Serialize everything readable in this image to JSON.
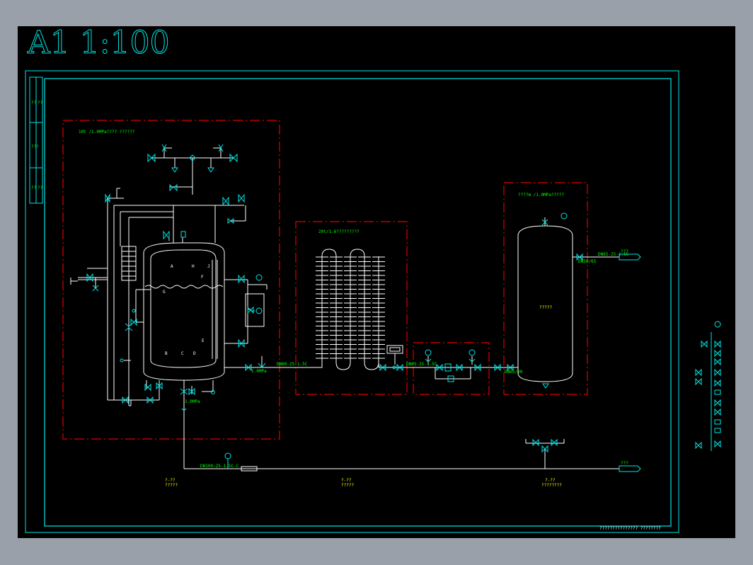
{
  "window": {
    "background": "#9aa0a9",
    "canvas_background": "#000000"
  },
  "colors": {
    "frame": "#00e5e5",
    "pipe": "#ffffff",
    "boundary": "#e00000",
    "text": "#00ff00",
    "note": "#ffff00"
  },
  "sheet": {
    "scale_title": "A1 1:100",
    "title_block_text": "???????????????  ????????"
  },
  "zones": {
    "boiler_room": {
      "label": "10t /1.0MPa???? ??????"
    },
    "cooler": {
      "label": "20t/1.6?????????"
    },
    "tank": {
      "label": "????m /1.0MPa?????"
    }
  },
  "pipe_labels": {
    "boiler_steam_out": "1.0MPa",
    "main_steam": "DN80-25-1.5C",
    "cooler_out": "DN65-25-1.5C",
    "tank_inlet": "DN65/80",
    "tank_outlet": "DN65-25-1.5C",
    "tank_outlet_size": "DN50/65",
    "boiler_down": "1.0MPa",
    "bottom_main": "DN100-25-1.5C-C",
    "outlet_top_arrow": "???",
    "outlet_bottom_arrow": "???"
  },
  "boiler_nozzles": [
    "A",
    "H",
    "J",
    "F",
    "G",
    "E",
    "B",
    "C",
    "D"
  ],
  "tank_center_label": "?????",
  "notes": [
    {
      "top": "?-??",
      "bottom": "?????"
    },
    {
      "top": "?-??",
      "bottom": "?????"
    },
    {
      "top": "?-??",
      "bottom": "????????"
    }
  ],
  "side_strip_labels": [
    "??",
    "??",
    "???",
    "??",
    "??"
  ]
}
